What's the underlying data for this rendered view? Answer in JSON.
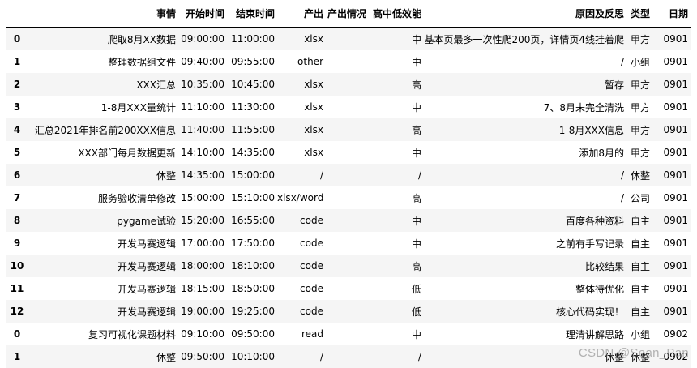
{
  "table": {
    "index_header": "",
    "columns": [
      "事情",
      "开始时间",
      "结束时间",
      "产出",
      "产出情况",
      "高中低效能",
      "原因及反思",
      "类型",
      "日期"
    ],
    "rows": [
      {
        "index": "0",
        "cells": [
          "爬取8月XX数据",
          "09:00:00",
          "11:00:00",
          "xlsx",
          "",
          "中",
          "基本页最多一次性爬200页，详情页4线挂着爬",
          "甲方",
          "0901"
        ]
      },
      {
        "index": "1",
        "cells": [
          "整理数据组文件",
          "09:40:00",
          "09:55:00",
          "other",
          "",
          "中",
          "/",
          "小组",
          "0901"
        ]
      },
      {
        "index": "2",
        "cells": [
          "XXX汇总",
          "10:35:00",
          "10:45:00",
          "xlsx",
          "",
          "高",
          "暂存",
          "甲方",
          "0901"
        ]
      },
      {
        "index": "3",
        "cells": [
          "1-8月XXX量统计",
          "11:10:00",
          "11:30:00",
          "xlsx",
          "",
          "中",
          "7、8月未完全清洗",
          "甲方",
          "0901"
        ]
      },
      {
        "index": "4",
        "cells": [
          "汇总2021年排名前200XXX信息",
          "11:40:00",
          "11:55:00",
          "xlsx",
          "",
          "高",
          "1-8月XXX信息",
          "甲方",
          "0901"
        ]
      },
      {
        "index": "5",
        "cells": [
          "XXX部门每月数据更新",
          "14:10:00",
          "14:35:00",
          "xlsx",
          "",
          "中",
          "添加8月的",
          "甲方",
          "0901"
        ]
      },
      {
        "index": "6",
        "cells": [
          "休整",
          "14:35:00",
          "15:00:00",
          "/",
          "",
          "/",
          "/",
          "休整",
          "0901"
        ]
      },
      {
        "index": "7",
        "cells": [
          "服务验收清单修改",
          "15:00:00",
          "15:10:00",
          "xlsx/word",
          "",
          "高",
          "/",
          "公司",
          "0901"
        ]
      },
      {
        "index": "8",
        "cells": [
          "pygame试验",
          "15:20:00",
          "16:55:00",
          "code",
          "",
          "中",
          "百度各种资料",
          "自主",
          "0901"
        ]
      },
      {
        "index": "9",
        "cells": [
          "开发马赛逻辑",
          "17:00:00",
          "17:50:00",
          "code",
          "",
          "中",
          "之前有手写记录",
          "自主",
          "0901"
        ]
      },
      {
        "index": "10",
        "cells": [
          "开发马赛逻辑",
          "18:00:00",
          "18:10:00",
          "code",
          "",
          "高",
          "比较结果",
          "自主",
          "0901"
        ]
      },
      {
        "index": "11",
        "cells": [
          "开发马赛逻辑",
          "18:15:00",
          "18:50:00",
          "code",
          "",
          "低",
          "整体待优化",
          "自主",
          "0901"
        ]
      },
      {
        "index": "12",
        "cells": [
          "开发马赛逻辑",
          "19:00:00",
          "19:25:00",
          "code",
          "",
          "低",
          "核心代码实现！",
          "自主",
          "0901"
        ]
      },
      {
        "index": "0",
        "cells": [
          "复习可视化课题材料",
          "09:10:00",
          "09:50:00",
          "read",
          "",
          "中",
          "理清讲解思路",
          "小组",
          "0902"
        ]
      },
      {
        "index": "1",
        "cells": [
          "休整",
          "09:50:00",
          "10:10:00",
          "/",
          "",
          "/",
          "休整",
          "休整",
          "0902"
        ]
      }
    ]
  },
  "watermark": "CSDN @Sean_Pan"
}
